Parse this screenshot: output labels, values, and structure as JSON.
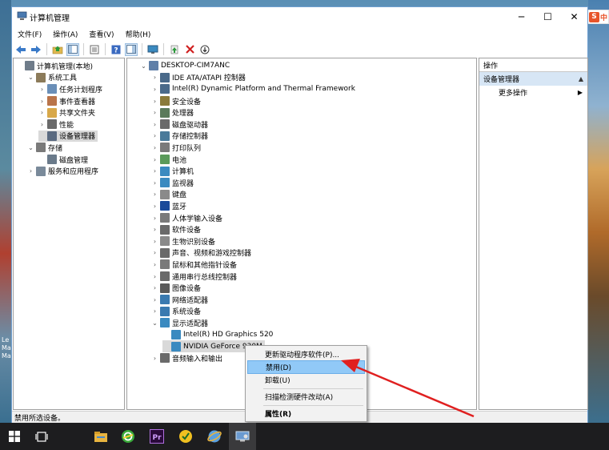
{
  "window": {
    "title": "计算机管理",
    "minimize": "─",
    "maximize": "☐",
    "close": "✕"
  },
  "ime": {
    "logo": "S",
    "text": "中"
  },
  "menu": [
    "文件(F)",
    "操作(A)",
    "查看(V)",
    "帮助(H)"
  ],
  "left_tree": [
    {
      "label": "计算机管理(本地)",
      "indent": 0,
      "twisty": "",
      "color": "#6f7c8a"
    },
    {
      "label": "系统工具",
      "indent": 1,
      "twisty": "⌄",
      "color": "#8c7b5a"
    },
    {
      "label": "任务计划程序",
      "indent": 2,
      "twisty": "›",
      "color": "#6a8fb8"
    },
    {
      "label": "事件查看器",
      "indent": 2,
      "twisty": "›",
      "color": "#b9744a"
    },
    {
      "label": "共享文件夹",
      "indent": 2,
      "twisty": "›",
      "color": "#d8a84a"
    },
    {
      "label": "性能",
      "indent": 2,
      "twisty": "›",
      "color": "#6a6a6a"
    },
    {
      "label": "设备管理器",
      "indent": 2,
      "twisty": "",
      "color": "#5a6a80",
      "selected": true
    },
    {
      "label": "存储",
      "indent": 1,
      "twisty": "⌄",
      "color": "#7a7a7a"
    },
    {
      "label": "磁盘管理",
      "indent": 2,
      "twisty": "",
      "color": "#6a7a8a"
    },
    {
      "label": "服务和应用程序",
      "indent": 1,
      "twisty": "›",
      "color": "#7a8a9a"
    }
  ],
  "device_tree": [
    {
      "label": "DESKTOP-CIM7ANC",
      "indent": 0,
      "twisty": "⌄",
      "color": "#5f7fa8"
    },
    {
      "label": "IDE ATA/ATAPI 控制器",
      "indent": 1,
      "twisty": "›",
      "color": "#4a6a8a"
    },
    {
      "label": "Intel(R) Dynamic Platform and Thermal Framework",
      "indent": 1,
      "twisty": "›",
      "color": "#4a6a8a"
    },
    {
      "label": "安全设备",
      "indent": 1,
      "twisty": "›",
      "color": "#8a7a3a"
    },
    {
      "label": "处理器",
      "indent": 1,
      "twisty": "›",
      "color": "#5a7a5a"
    },
    {
      "label": "磁盘驱动器",
      "indent": 1,
      "twisty": "›",
      "color": "#6a6a6a"
    },
    {
      "label": "存储控制器",
      "indent": 1,
      "twisty": "›",
      "color": "#4a7a9a"
    },
    {
      "label": "打印队列",
      "indent": 1,
      "twisty": "›",
      "color": "#7a7a7a"
    },
    {
      "label": "电池",
      "indent": 1,
      "twisty": "›",
      "color": "#5a9a5a"
    },
    {
      "label": "计算机",
      "indent": 1,
      "twisty": "›",
      "color": "#3a8ac0"
    },
    {
      "label": "监视器",
      "indent": 1,
      "twisty": "›",
      "color": "#3a8ac0"
    },
    {
      "label": "键盘",
      "indent": 1,
      "twisty": "›",
      "color": "#8a8a8a"
    },
    {
      "label": "蓝牙",
      "indent": 1,
      "twisty": "›",
      "color": "#1a4a9a"
    },
    {
      "label": "人体学输入设备",
      "indent": 1,
      "twisty": "›",
      "color": "#7a7a7a"
    },
    {
      "label": "软件设备",
      "indent": 1,
      "twisty": "›",
      "color": "#6a6a6a"
    },
    {
      "label": "生物识别设备",
      "indent": 1,
      "twisty": "›",
      "color": "#8a8a8a"
    },
    {
      "label": "声音、视频和游戏控制器",
      "indent": 1,
      "twisty": "›",
      "color": "#6a6a6a"
    },
    {
      "label": "鼠标和其他指针设备",
      "indent": 1,
      "twisty": "›",
      "color": "#7a7a7a"
    },
    {
      "label": "通用串行总线控制器",
      "indent": 1,
      "twisty": "›",
      "color": "#6a6a6a"
    },
    {
      "label": "图像设备",
      "indent": 1,
      "twisty": "›",
      "color": "#5a5a5a"
    },
    {
      "label": "网络适配器",
      "indent": 1,
      "twisty": "›",
      "color": "#3a7ab0"
    },
    {
      "label": "系统设备",
      "indent": 1,
      "twisty": "›",
      "color": "#3a7ab0"
    },
    {
      "label": "显示适配器",
      "indent": 1,
      "twisty": "⌄",
      "color": "#3a8ac0"
    },
    {
      "label": "Intel(R) HD Graphics 520",
      "indent": 2,
      "twisty": "",
      "color": "#3a8ac0"
    },
    {
      "label": "NVIDIA GeForce 930M",
      "indent": 2,
      "twisty": "",
      "color": "#3a8ac0",
      "selected": true
    },
    {
      "label": "音频输入和输出",
      "indent": 1,
      "twisty": "›",
      "color": "#6a6a6a"
    }
  ],
  "actions": {
    "header": "操作",
    "section": "设备管理器",
    "more": "更多操作"
  },
  "status": "禁用所选设备。",
  "context_menu": {
    "update": "更新驱动程序软件(P)...",
    "disable": "禁用(D)",
    "uninstall": "卸载(U)",
    "scan": "扫描检测硬件改动(A)",
    "properties": "属性(R)"
  },
  "colors": {
    "accent_red_arrow": "#e02020",
    "menu_highlight": "#91c9f7",
    "selection_gray": "#d9d9d9",
    "taskbar": "#1d1d1f"
  },
  "taskbar_icons": [
    "start-icon",
    "task-view-icon",
    "file-explorer-icon",
    "browser-360-icon",
    "premiere-icon",
    "norton-icon",
    "browser-icon",
    "computer-management-icon"
  ]
}
